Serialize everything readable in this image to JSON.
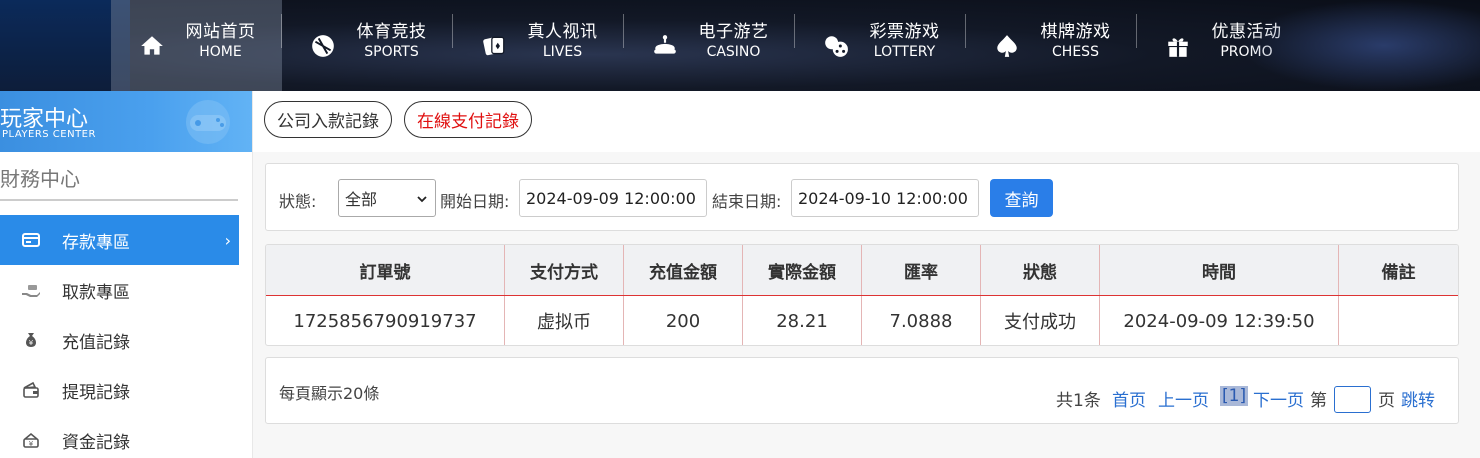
{
  "nav": {
    "items": [
      {
        "cn": "网站首页",
        "en": "HOME",
        "icon": "home-icon"
      },
      {
        "cn": "体育竞技",
        "en": "SPORTS",
        "icon": "ball-icon"
      },
      {
        "cn": "真人视讯",
        "en": "LIVES",
        "icon": "cards-icon"
      },
      {
        "cn": "电子游艺",
        "en": "CASINO",
        "icon": "slot-icon"
      },
      {
        "cn": "彩票游戏",
        "en": "LOTTERY",
        "icon": "dice-icon"
      },
      {
        "cn": "棋牌游戏",
        "en": "CHESS",
        "icon": "spade-icon"
      },
      {
        "cn": "优惠活动",
        "en": "PROMO",
        "icon": "gift-icon"
      }
    ]
  },
  "sidebar": {
    "banner_cn": "玩家中心",
    "banner_en": "PLAYERS CENTER",
    "section_title": "財務中心",
    "items": [
      {
        "label": "存款專區",
        "icon": "deposit-card-icon"
      },
      {
        "label": "取款專區",
        "icon": "withdraw-hand-icon"
      },
      {
        "label": "充值記錄",
        "icon": "money-bag-icon"
      },
      {
        "label": "提現記錄",
        "icon": "wallet-icon"
      },
      {
        "label": "資金記錄",
        "icon": "funds-icon"
      }
    ]
  },
  "tabs": {
    "company": "公司入款記錄",
    "online": "在線支付記錄"
  },
  "filter": {
    "status_label": "狀態:",
    "status_value": "全部",
    "start_label": "開始日期:",
    "start_value": "2024-09-09 12:00:00",
    "end_label": "結束日期:",
    "end_value": "2024-09-10 12:00:00",
    "query": "查詢"
  },
  "table": {
    "headers": [
      "訂單號",
      "支付方式",
      "充值金額",
      "實際金額",
      "匯率",
      "狀態",
      "時間",
      "備註"
    ],
    "rows": [
      [
        "1725856790919737",
        "虚拟币",
        "200",
        "28.21",
        "7.0888",
        "支付成功",
        "2024-09-09 12:39:50",
        ""
      ]
    ]
  },
  "pager": {
    "per_page": "每頁顯示20條",
    "total": "共1条",
    "first": "首页",
    "prev": "上一页",
    "current": "[1]",
    "next": "下一页",
    "di": "第",
    "ye": "页",
    "jump": "跳转"
  },
  "colors": {
    "accent": "#2a8be8",
    "active_tab_text": "#e01010",
    "header_border": "#dd3333"
  }
}
